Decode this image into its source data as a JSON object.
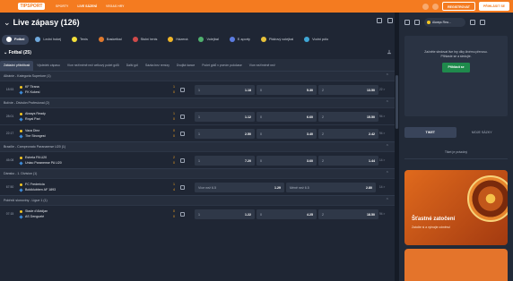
{
  "topbar": {
    "logo": "TIPSPORT",
    "nav": [
      "SPORTY",
      "LIVE SÁZENÍ",
      "VEGAS HRY"
    ],
    "right": {
      "register": "REGISTROVAT",
      "login": "PŘIHLÁSIT SE"
    },
    "brand_color": "#f47b20"
  },
  "page": {
    "title": "Live zápasy (126)"
  },
  "sports": [
    {
      "label": "Fotbal",
      "icon": "soccer-ball-icon",
      "color": "#ffffff"
    },
    {
      "label": "Lední hokej",
      "icon": "hockey-icon",
      "color": "#6fa8dc"
    },
    {
      "label": "Tenis",
      "icon": "tennis-ball-icon",
      "color": "#f3e03a"
    },
    {
      "label": "Basketbal",
      "icon": "basketball-icon",
      "color": "#e0792d"
    },
    {
      "label": "Stolní tenis",
      "icon": "table-tennis-icon",
      "color": "#d04a4a"
    },
    {
      "label": "Házená",
      "icon": "handball-icon",
      "color": "#f0b528"
    },
    {
      "label": "Volejbal",
      "icon": "volleyball-icon",
      "color": "#4fb06e"
    },
    {
      "label": "E-sporty",
      "icon": "gamepad-icon",
      "color": "#5c7ce0"
    },
    {
      "label": "Plážový volejbal",
      "icon": "beach-volleyball-icon",
      "color": "#e8c23a"
    },
    {
      "label": "Vodní pólo",
      "icon": "waterpolo-icon",
      "color": "#3fa7d6"
    }
  ],
  "section": {
    "title": "Fotbal (25)"
  },
  "tabs": [
    "Základní příležitosti",
    "Výsledek zápasu",
    "Více než/méně než celkový počet gólů",
    "Další gól",
    "Sázka bez remízy",
    "Dvojitá šance",
    "Počet gólů v prvním poločase",
    "Více než/méně než"
  ],
  "leagues": [
    {
      "name": "Albánie - Kategoria Superiore (1)",
      "matches": [
        {
          "time": "18:53",
          "home": "KF Tirana",
          "away": "FK Kukesi",
          "score_home": "1",
          "score_away": "0",
          "odds": [
            {
              "label": "1",
              "value": "1.18"
            },
            {
              "label": "0",
              "value": "5.30"
            },
            {
              "label": "2",
              "value": "13.50"
            }
          ],
          "more": "22 >"
        }
      ]
    },
    {
      "name": "Bolívie - División Profesional (2)",
      "matches": [
        {
          "time": "28:01",
          "home": "Always Ready",
          "away": "Royal Pari",
          "score_home": "1",
          "score_away": "0",
          "odds": [
            {
              "label": "1",
              "value": "1.12"
            },
            {
              "label": "0",
              "value": "6.60"
            },
            {
              "label": "2",
              "value": "15.50"
            }
          ],
          "more": "94 >"
        },
        {
          "time": "22:17",
          "home": "Vaca Diez",
          "away": "The Strongest",
          "score_home": "0",
          "score_away": "0",
          "odds": [
            {
              "label": "1",
              "value": "2.50"
            },
            {
              "label": "0",
              "value": "3.40"
            },
            {
              "label": "2",
              "value": "2.42"
            }
          ],
          "more": "94 >"
        }
      ]
    },
    {
      "name": "Brazílie - Campeonato Paranaense U20 (1)",
      "matches": [
        {
          "time": "45:08",
          "home": "Estrela PA U20",
          "away": "Uniao Paranense PA U20",
          "score_home": "2",
          "score_away": "0",
          "odds": [
            {
              "label": "1",
              "value": "7.20"
            },
            {
              "label": "0",
              "value": "3.60"
            },
            {
              "label": "2",
              "value": "1.44"
            }
          ],
          "more": "14 >"
        }
      ]
    },
    {
      "name": "Dánsko - 1. Division (1)",
      "matches": [
        {
          "time": "67:50",
          "home": "FC Fredericia",
          "away": "Boldklubben AF 1893",
          "score_home": "1",
          "score_away": "4",
          "odds": [
            {
              "label": "Více než 6.5",
              "value": "1.29"
            },
            {
              "label": "Méně než 6.5",
              "value": "2.80"
            }
          ],
          "more": "14 >"
        }
      ]
    },
    {
      "name": "Pobřeží slonoviny - Ligue 1 (1)",
      "matches": [
        {
          "time": "07:15",
          "home": "Stade d'Abidjan",
          "away": "AS Denguelé",
          "score_home": "0",
          "score_away": "0",
          "odds": [
            {
              "label": "1",
              "value": "1.22"
            },
            {
              "label": "0",
              "value": "4.25"
            },
            {
              "label": "2",
              "value": "18.50"
            }
          ],
          "more": "94 >"
        }
      ]
    }
  ],
  "sidebar": {
    "stream_select": "Always Rea...",
    "stream_text": "Začněte sledovat live hry díky živému přenosu. Přihlaste se a sledujte.",
    "stream_button": "Přihlásit se",
    "ticket_tabs": [
      "TIKET",
      "MOJE SÁZKY"
    ],
    "ticket_empty": "Tiket je prázdný",
    "promo_title": "Šťastné zatočení",
    "promo_text": "Zatočte si a vyhrajte odměnu!"
  }
}
